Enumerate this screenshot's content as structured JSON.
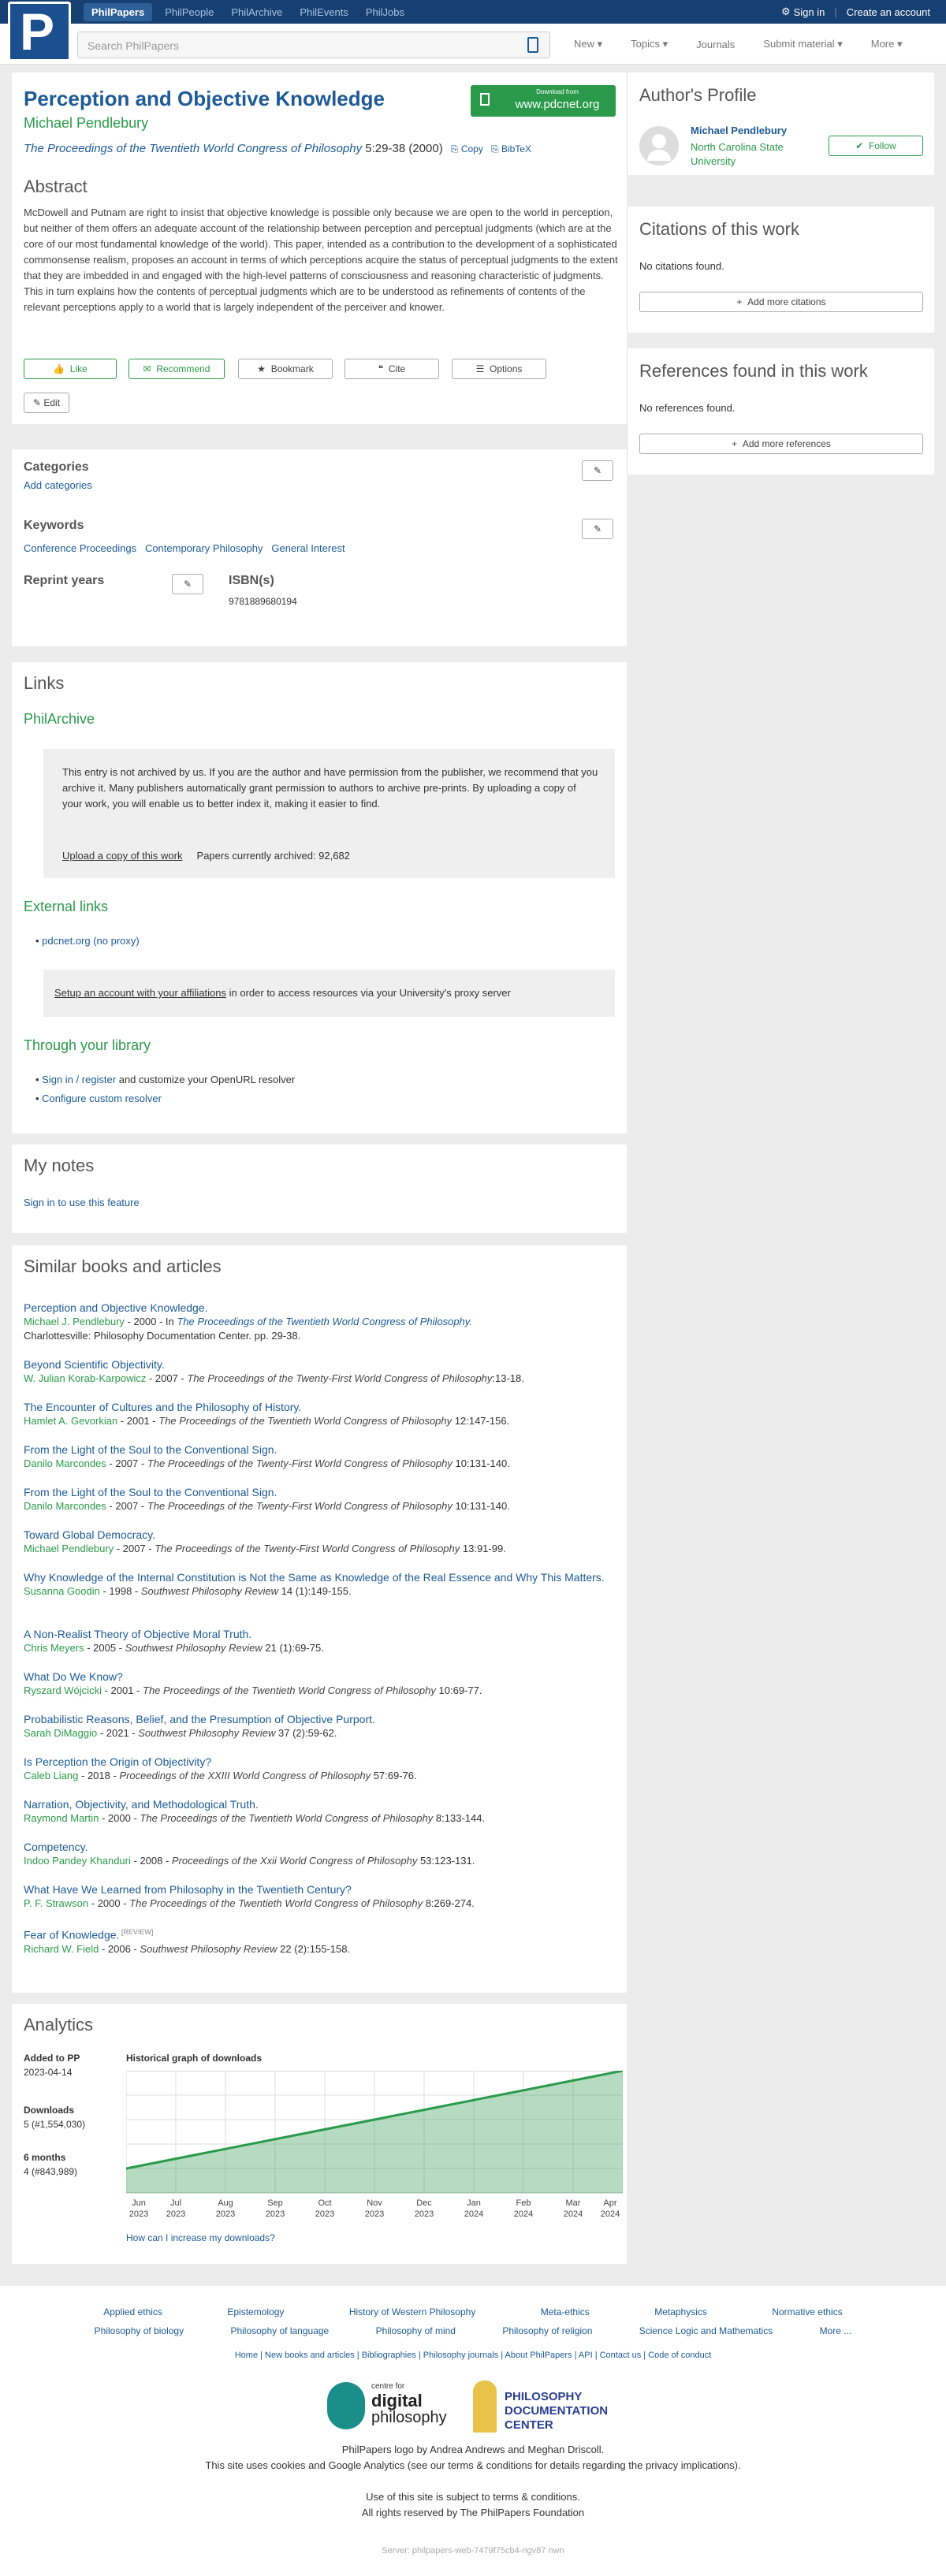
{
  "topbar": {
    "brand": "PhilPapers",
    "links": [
      "PhilPeople",
      "PhilArchive",
      "PhilEvents",
      "PhilJobs"
    ],
    "signin": "Sign in",
    "create": "Create an account"
  },
  "search": {
    "placeholder": "Search PhilPapers"
  },
  "menu": [
    "New",
    "Topics",
    "Journals",
    "Submit material",
    "More"
  ],
  "paper": {
    "title": "Perception and Objective Knowledge",
    "author": "Michael Pendlebury",
    "venue": "The Proceedings of the Twentieth World Congress of Philosophy",
    "pages": "5:29-38 (2000)",
    "copy": "Copy",
    "bibtex": "BibTeX",
    "download_small": "Download from",
    "download_site": "www.pdcnet.org"
  },
  "abstract": {
    "heading": "Abstract",
    "text": "McDowell and Putnam are right to insist that objective knowledge is possible only because we are open to the world in perception, but neither of them offers an adequate account of the relationship between perception and perceptual judgments (which are at the core of our most fundamental knowledge of the world). This paper, intended as a contribution to the development of a sophisticated commonsense realism, proposes an account in terms of which perceptions acquire the status of perceptual judgments to the extent that they are imbedded in and engaged with the high-level patterns of consciousness and reasoning characteristic of judgments. This in turn explains how the contents of perceptual judgments which are to be understood as refinements of contents of the relevant perceptions apply to a world that is largely independent of the perceiver and knower."
  },
  "actions": {
    "like": "Like",
    "recommend": "Recommend",
    "bookmark": "Bookmark",
    "cite": "Cite",
    "options": "Options",
    "edit": "Edit"
  },
  "meta": {
    "categories": "Categories",
    "add_categories": "Add categories",
    "keywords": "Keywords",
    "kw": [
      "Conference Proceedings",
      "Contemporary Philosophy",
      "General Interest"
    ],
    "reprint": "Reprint years",
    "isbn_label": "ISBN(s)",
    "isbn": "9781889680194"
  },
  "links": {
    "heading": "Links",
    "philarchive": "PhilArchive",
    "archive_note": "This entry is not archived by us. If you are the author and have permission from the publisher, we recommend that you archive it. Many publishers automatically grant permission to authors to archive pre-prints. By uploading a copy of your work, you will enable us to better index it, making it easier to find.",
    "upload": "Upload a copy of this work",
    "archived": "Papers currently archived: 92,682",
    "external": "External links",
    "pdcnet": "pdcnet.org (no proxy)",
    "proxy_link": "Setup an account with your affiliations",
    "proxy_rest": " in order to access resources via your University's proxy server",
    "library": "Through your library",
    "signin": "Sign in / register",
    "signin_rest": " and customize your OpenURL resolver",
    "configure": "Configure custom resolver"
  },
  "notes": {
    "heading": "My notes",
    "signin": "Sign in to use this feature"
  },
  "similar": {
    "heading": "Similar books and articles",
    "items": [
      {
        "t": "Perception and Objective Knowledge.",
        "a": "Michael J. Pendlebury",
        "r": " - 2000 - In ",
        "j": "The Proceedings of the Twentieth World Congress of Philosophy.",
        "extra": "Charlottesville: Philosophy Documentation Center. pp. 29-38."
      },
      {
        "t": "Beyond Scientific Objectivity.",
        "a": "W. Julian Korab-Karpowicz",
        "r": " - 2007 - ",
        "j": "The Proceedings of the Twenty-First World Congress of Philosophy",
        "p": ":13-18."
      },
      {
        "t": "The Encounter of Cultures and the Philosophy of History.",
        "a": "Hamlet A. Gevorkian",
        "r": " - 2001 - ",
        "j": "The Proceedings of the Twentieth World Congress of Philosophy",
        "p": " 12:147-156."
      },
      {
        "t": "From the Light of the Soul to the Conventional Sign.",
        "a": "Danilo Marcondes",
        "r": " - 2007 - ",
        "j": "The Proceedings of the Twenty-First World Congress of Philosophy",
        "p": " 10:131-140."
      },
      {
        "t": "From the Light of the Soul to the Conventional Sign.",
        "a": "Danilo Marcondes",
        "r": " - 2007 - ",
        "j": "The Proceedings of the Twenty-First World Congress of Philosophy",
        "p": " 10:131-140."
      },
      {
        "t": "Toward Global Democracy.",
        "a": "Michael Pendlebury",
        "r": " - 2007 - ",
        "j": "The Proceedings of the Twenty-First World Congress of Philosophy",
        "p": " 13:91-99."
      },
      {
        "t": "Why Knowledge of the Internal Constitution is Not the Same as Knowledge of the Real Essence and Why This Matters.",
        "a": "Susanna Goodin",
        "r": " - 1998 - ",
        "j": "Southwest Philosophy Review",
        "p": " 14 (1):149-155."
      },
      {
        "t": "A Non-Realist Theory of Objective Moral Truth.",
        "a": "Chris Meyers",
        "r": " - 2005 - ",
        "j": "Southwest Philosophy Review",
        "p": " 21 (1):69-75."
      },
      {
        "t": "What Do We Know?",
        "a": "Ryszard Wójcicki",
        "r": " - 2001 - ",
        "j": "The Proceedings of the Twentieth World Congress of Philosophy",
        "p": " 10:69-77."
      },
      {
        "t": "Probabilistic Reasons, Belief, and the Presumption of Objective Purport.",
        "a": "Sarah DiMaggio",
        "r": " - 2021 - ",
        "j": "Southwest Philosophy Review",
        "p": " 37 (2):59-62."
      },
      {
        "t": "Is Perception the Origin of Objectivity?",
        "a": "Caleb Liang",
        "r": " - 2018 - ",
        "j": "Proceedings of the XXIII World Congress of Philosophy",
        "p": " 57:69-76."
      },
      {
        "t": "Narration, Objectivity, and Methodological Truth.",
        "a": "Raymond Martin",
        "r": " - 2000 - ",
        "j": "The Proceedings of the Twentieth World Congress of Philosophy",
        "p": " 8:133-144."
      },
      {
        "t": "Competency.",
        "a": "Indoo Pandey Khanduri",
        "r": " - 2008 - ",
        "j": "Proceedings of the Xxii World Congress of Philosophy",
        "p": " 53:123-131."
      },
      {
        "t": "What Have We Learned from Philosophy in the Twentieth Century?",
        "a": "P. F. Strawson",
        "r": " - 2000 - ",
        "j": "The Proceedings of the Twentieth World Congress of Philosophy",
        "p": " 8:269-274."
      },
      {
        "t": "Fear of Knowledge.",
        "tag": "[REVIEW]",
        "a": "Richard W. Field",
        "r": " - 2006 - ",
        "j": "Southwest Philosophy Review",
        "p": " 22 (2):155-158."
      }
    ]
  },
  "analytics": {
    "heading": "Analytics",
    "added_label": "Added to PP",
    "added": "2023-04-14",
    "downloads_label": "Downloads",
    "downloads": "5 (#1,554,030)",
    "six_label": "6 months",
    "six": "4 (#843,989)",
    "graph_title": "Historical graph of downloads",
    "increase": "How can I increase my downloads?"
  },
  "chart_data": {
    "type": "area",
    "title": "Historical graph of downloads",
    "categories": [
      "Jun 2023",
      "Jul 2023",
      "Aug 2023",
      "Sep 2023",
      "Oct 2023",
      "Nov 2023",
      "Dec 2023",
      "Jan 2024",
      "Feb 2024",
      "Mar 2024",
      "Apr 2024"
    ],
    "values": [
      1,
      1.4,
      1.8,
      2.2,
      2.6,
      3,
      3.4,
      3.8,
      4.2,
      4.6,
      5
    ],
    "ylim": [
      0,
      5
    ],
    "grid": true,
    "color": "#2a9a4a"
  },
  "sidebar": {
    "profile": "Author's Profile",
    "author": "Michael Pendlebury",
    "affil": "North Carolina State University",
    "follow": "Follow",
    "citations": "Citations of this work",
    "no_citations": "No citations found.",
    "add_citations": "Add more citations",
    "references": "References found in this work",
    "no_refs": "No references found.",
    "add_refs": "Add more references"
  },
  "footer": {
    "cats1": [
      "Applied ethics",
      "Epistemology",
      "History of Western Philosophy",
      "Meta-ethics",
      "Metaphysics",
      "Normative ethics"
    ],
    "cats2": [
      "Philosophy of biology",
      "Philosophy of language",
      "Philosophy of mind",
      "Philosophy of religion",
      "Science Logic and Mathematics",
      "More ..."
    ],
    "links": "Home | New books and articles | Bibliographies | Philosophy journals | About PhilPapers | API | Contact us | Code of conduct",
    "logo1a": "centre for",
    "logo1b": "digital",
    "logo1c": "philosophy",
    "logo2a": "PHILOSOPHY",
    "logo2b": "DOCUMENTATION",
    "logo2c": "CENTER",
    "credit": "PhilPapers logo by Andrea Andrews and Meghan Driscoll.",
    "cookies": "This site uses cookies and Google Analytics (see our terms & conditions for details regarding the privacy implications).",
    "terms": "Use of this site is subject to terms & conditions.",
    "rights": "All rights reserved by The PhilPapers Foundation",
    "server": "Server: philpapers-web-7479f75cb4-ngv87 nwn"
  }
}
